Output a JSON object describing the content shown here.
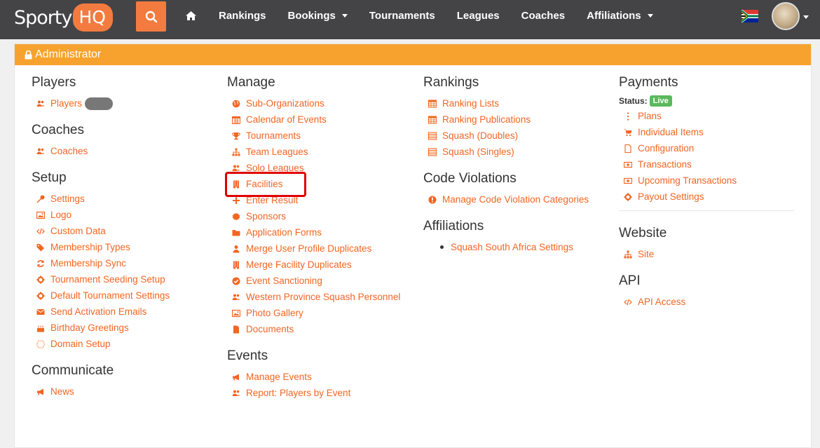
{
  "brand": {
    "sporty": "Sporty",
    "hq": "HQ"
  },
  "nav": {
    "items": [
      {
        "label": "Rankings"
      },
      {
        "label": "Bookings",
        "dropdown": true
      },
      {
        "label": "Tournaments"
      },
      {
        "label": "Leagues"
      },
      {
        "label": "Coaches"
      },
      {
        "label": "Affiliations",
        "dropdown": true
      }
    ]
  },
  "colors": {
    "accent": "#f47b3f",
    "link": "#f26522",
    "header": "#f7a22e",
    "live": "#5cb85c",
    "highlight": "#e00000"
  },
  "panel": {
    "title": "Administrator"
  },
  "players": {
    "title": "Players",
    "items": [
      {
        "label": "Players",
        "icon": "users-icon"
      }
    ]
  },
  "coaches": {
    "title": "Coaches",
    "items": [
      {
        "label": "Coaches",
        "icon": "users-icon"
      }
    ]
  },
  "setup": {
    "title": "Setup",
    "items": [
      {
        "label": "Settings",
        "icon": "wrench-icon"
      },
      {
        "label": "Logo",
        "icon": "image-icon"
      },
      {
        "label": "Custom Data",
        "icon": "code-icon"
      },
      {
        "label": "Membership Types",
        "icon": "tags-icon"
      },
      {
        "label": "Membership Sync",
        "icon": "refresh-icon"
      },
      {
        "label": "Tournament Seeding Setup",
        "icon": "cog-icon"
      },
      {
        "label": "Default Tournament Settings",
        "icon": "cog-icon"
      },
      {
        "label": "Send Activation Emails",
        "icon": "envelope-icon"
      },
      {
        "label": "Birthday Greetings",
        "icon": "cake-icon"
      },
      {
        "label": "Domain Setup",
        "icon": "globe-icon"
      }
    ]
  },
  "communicate": {
    "title": "Communicate",
    "items": [
      {
        "label": "News",
        "icon": "bullhorn-icon"
      }
    ]
  },
  "manage": {
    "title": "Manage",
    "items": [
      {
        "label": "Sub-Organizations",
        "icon": "globe-icon"
      },
      {
        "label": "Calendar of Events",
        "icon": "calendar-icon"
      },
      {
        "label": "Tournaments",
        "icon": "trophy-icon"
      },
      {
        "label": "Team Leagues",
        "icon": "sitemap-icon"
      },
      {
        "label": "Solo Leagues",
        "icon": "users-icon"
      },
      {
        "label": "Facilities",
        "icon": "building-icon"
      },
      {
        "label": "Enter Result",
        "icon": "plus-icon"
      },
      {
        "label": "Sponsors",
        "icon": "certificate-icon"
      },
      {
        "label": "Application Forms",
        "icon": "folder-icon"
      },
      {
        "label": "Merge User Profile Duplicates",
        "icon": "user-icon"
      },
      {
        "label": "Merge Facility Duplicates",
        "icon": "building-icon"
      },
      {
        "label": "Event Sanctioning",
        "icon": "check-circle-icon"
      },
      {
        "label": "Western Province Squash Personnel",
        "icon": "users-icon"
      },
      {
        "label": "Photo Gallery",
        "icon": "image-icon"
      },
      {
        "label": "Documents",
        "icon": "file-icon"
      }
    ]
  },
  "events": {
    "title": "Events",
    "items": [
      {
        "label": "Manage Events",
        "icon": "bullhorn-icon"
      },
      {
        "label": "Report: Players by Event",
        "icon": "users-icon"
      }
    ]
  },
  "rankings": {
    "title": "Rankings",
    "items": [
      {
        "label": "Ranking Lists",
        "icon": "table-icon"
      },
      {
        "label": "Ranking Publications",
        "icon": "table-icon"
      },
      {
        "label": "Squash (Doubles)",
        "icon": "list-icon"
      },
      {
        "label": "Squash (Singles)",
        "icon": "list-icon"
      }
    ]
  },
  "code_violations": {
    "title": "Code Violations",
    "items": [
      {
        "label": "Manage Code Violation Categories",
        "icon": "exclamation-circle-icon"
      }
    ]
  },
  "affiliations": {
    "title": "Affiliations",
    "items": [
      {
        "label": "Squash South Africa Settings"
      }
    ]
  },
  "payments": {
    "title": "Payments",
    "status_label": "Status:",
    "status_value": "Live",
    "items": [
      {
        "label": "Plans",
        "icon": "ellipsis-vertical-icon"
      },
      {
        "label": "Individual Items",
        "icon": "cart-icon"
      },
      {
        "label": "Configuration",
        "icon": "file-icon"
      },
      {
        "label": "Transactions",
        "icon": "money-icon"
      },
      {
        "label": "Upcoming Transactions",
        "icon": "money-icon"
      },
      {
        "label": "Payout Settings",
        "icon": "cog-icon"
      }
    ]
  },
  "website": {
    "title": "Website",
    "items": [
      {
        "label": "Site",
        "icon": "sitemap-icon"
      }
    ]
  },
  "api": {
    "title": "API",
    "items": [
      {
        "label": "API Access",
        "icon": "code-icon"
      }
    ]
  }
}
